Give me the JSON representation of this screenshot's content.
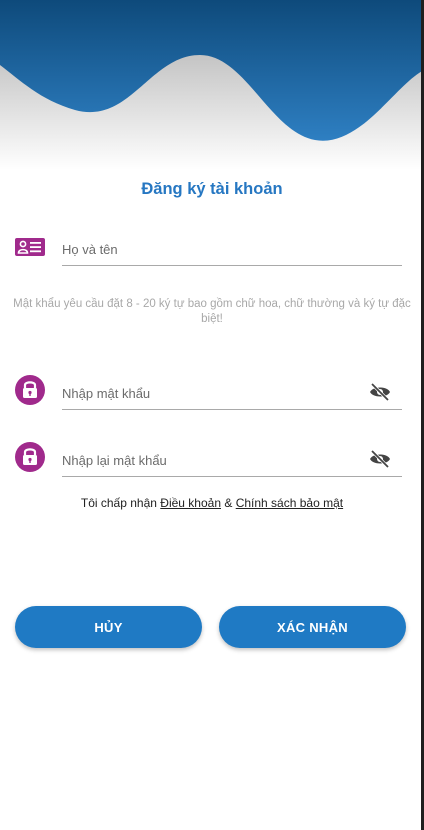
{
  "header": {
    "title": "Đăng ký tài khoản"
  },
  "form": {
    "fullname": {
      "placeholder": "Họ và tên",
      "icon": "id-card-icon"
    },
    "password_hint": "Mật khẩu yêu cầu đặt 8 - 20 ký tự bao gồm chữ hoa, chữ thường và ký tự đặc biệt!",
    "password": {
      "placeholder": "Nhập mật khẩu",
      "icon": "lock-icon",
      "toggle_icon": "eye-off-icon"
    },
    "confirm_password": {
      "placeholder": "Nhập lại mật khẩu",
      "icon": "lock-icon",
      "toggle_icon": "eye-off-icon"
    }
  },
  "terms": {
    "prefix": "Tôi chấp nhận",
    "terms_link": "Điều khoản",
    "separator": "&",
    "privacy_link": "Chính sách bảo mật"
  },
  "actions": {
    "cancel_label": "HỦY",
    "confirm_label": "XÁC NHẬN"
  },
  "colors": {
    "header_blue": "#1b5f97",
    "accent_blue": "#2677c2",
    "button_blue": "#1f7ac4",
    "icon_purple": "#a02a8c"
  }
}
